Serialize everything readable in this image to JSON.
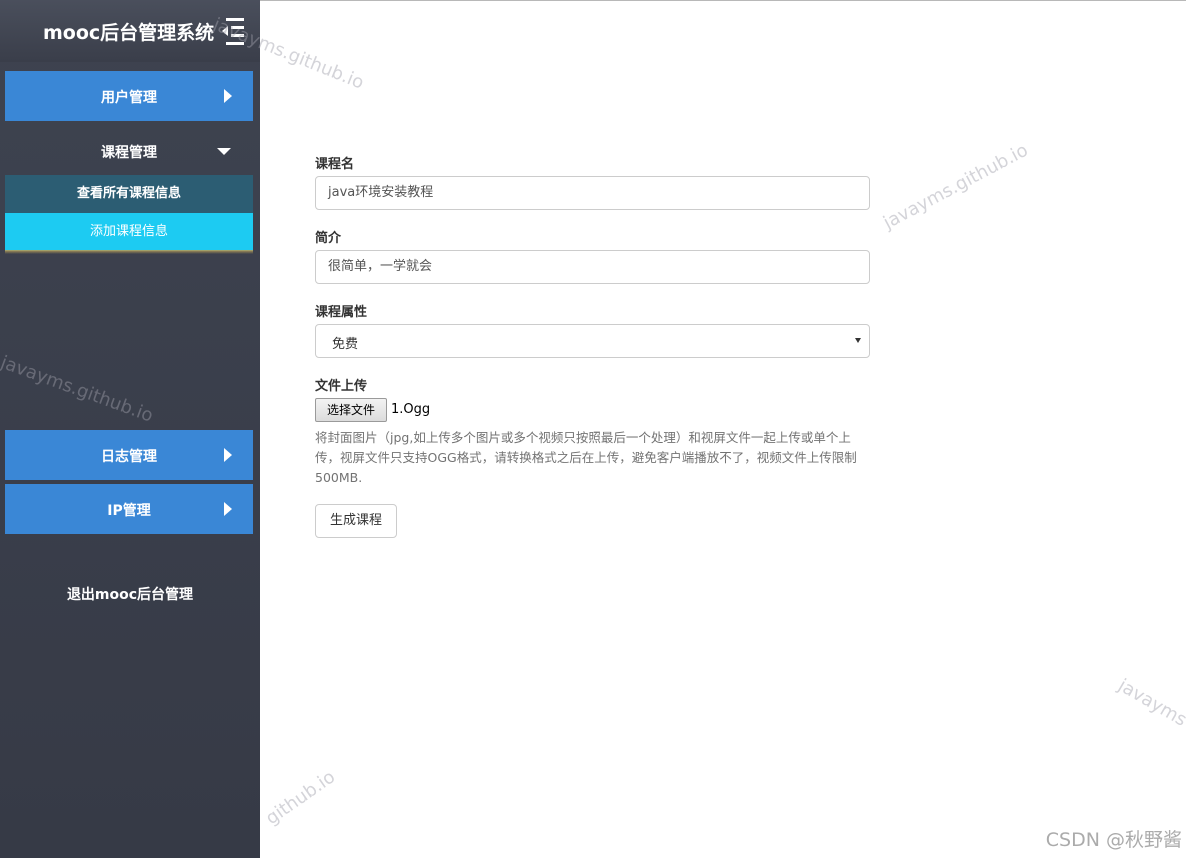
{
  "app": {
    "title": "mooc后台管理系统"
  },
  "sidebar": {
    "menu_toggle_icon": "indent-menu-icon",
    "items": [
      {
        "label": "用户管理",
        "state": "collapsed"
      },
      {
        "label": "课程管理",
        "state": "expanded",
        "children": [
          {
            "label": "查看所有课程信息",
            "active": false
          },
          {
            "label": "添加课程信息",
            "active": true
          }
        ]
      },
      {
        "label": "日志管理",
        "state": "collapsed"
      },
      {
        "label": "IP管理",
        "state": "collapsed"
      }
    ],
    "logout_label": "退出mooc后台管理"
  },
  "form": {
    "course_name": {
      "label": "课程名",
      "value": "java环境安装教程"
    },
    "intro": {
      "label": "简介",
      "value": "很简单，一学就会"
    },
    "attribute": {
      "label": "课程属性",
      "selected": "免费"
    },
    "upload": {
      "label": "文件上传",
      "button_label": "选择文件",
      "file_name": "1.Ogg",
      "help": "将封面图片（jpg,如上传多个图片或多个视频只按照最后一个处理）和视屏文件一起上传或单个上传，视屏文件只支持OGG格式，请转换格式之后在上传，避免客户端播放不了，视频文件上传限制500MB."
    },
    "submit_label": "生成课程"
  },
  "watermarks": [
    "javayms.github.io",
    "javayms.github.io",
    "javayms.github.io",
    "javayms",
    "github.io"
  ],
  "credit": "CSDN @秋野酱",
  "colors": {
    "sidebar_bg": "#3a3e4a",
    "nav_blue": "#3a87d6",
    "sub_dark": "#2c5d73",
    "sub_active": "#1dcbf2"
  }
}
